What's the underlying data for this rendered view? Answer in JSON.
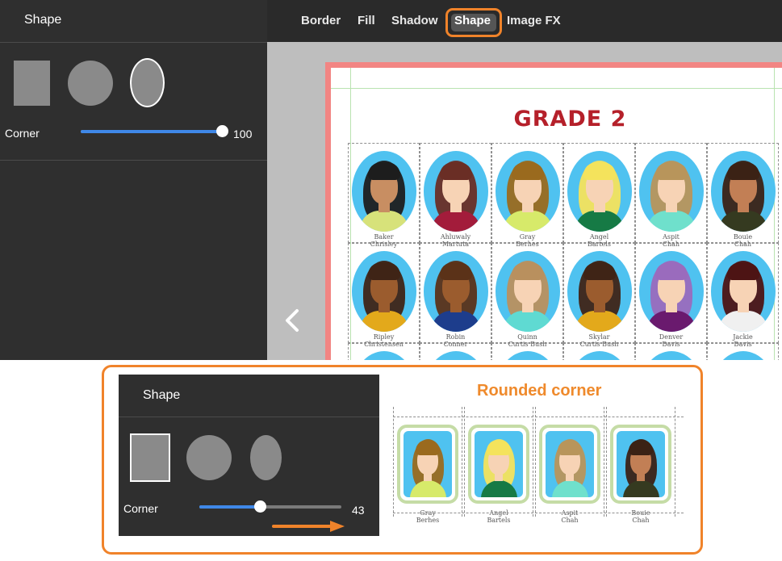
{
  "sidebar": {
    "title": "Shape",
    "shapes": [
      "rectangle-shape",
      "circle-shape",
      "oval-shape"
    ],
    "selected_shape": "oval-shape",
    "corner_label": "Corner",
    "corner_value": "100",
    "corner_level": 1.0
  },
  "toolbar": {
    "tabs": [
      "Border",
      "Fill",
      "Shadow",
      "Shape",
      "Image FX"
    ],
    "active_tab": "Shape"
  },
  "canvas": {
    "title": "GRADE 2",
    "back_icon": "chevron-left-icon",
    "rows": [
      [
        "Baker\nChrisley",
        "Ahluwaly\nMartuta",
        "Gray\nBerhes",
        "Angel\nBartels",
        "Aspit\nChah",
        "Bouie\nChah"
      ],
      [
        "Ripley\nChristensen",
        "Robin\nConner",
        "Quinn\nCurtis Bush",
        "Skylar\nCurtis Bush",
        "Denver\nDavis",
        "Jackie\nDavis"
      ]
    ]
  },
  "callout": {
    "panel_title": "Shape",
    "selected_shape": "rectangle-shape",
    "corner_label": "Corner",
    "corner_value": "43",
    "corner_level": 0.43,
    "heading": "Rounded corner",
    "names": [
      "Gray\nBerhes",
      "Angel\nBartels",
      "Aspit\nChah",
      "Bouie\nChah"
    ]
  },
  "colors": {
    "accent": "#f0832a",
    "slider": "#3f88e8",
    "page_border": "#f28583",
    "title": "#b5202a"
  }
}
